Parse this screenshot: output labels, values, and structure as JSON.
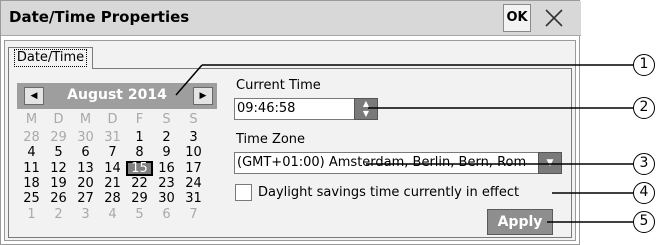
{
  "window": {
    "title": "Date/Time Properties",
    "ok_label": "OK",
    "close_icon": "close-icon"
  },
  "tabs": [
    {
      "label": "Date/Time",
      "active": true
    }
  ],
  "calendar": {
    "month_label": "August 2014",
    "prev_icon": "triangle-left-icon",
    "next_icon": "triangle-right-icon",
    "weekdays": [
      "M",
      "D",
      "M",
      "D",
      "F",
      "S",
      "S"
    ],
    "weeks": [
      [
        "28",
        "29",
        "30",
        "31",
        "1",
        "2",
        "3"
      ],
      [
        "4",
        "5",
        "6",
        "7",
        "8",
        "9",
        "10"
      ],
      [
        "11",
        "12",
        "13",
        "14",
        "15",
        "16",
        "17"
      ],
      [
        "18",
        "19",
        "20",
        "21",
        "22",
        "23",
        "24"
      ],
      [
        "25",
        "26",
        "27",
        "28",
        "29",
        "30",
        "31"
      ],
      [
        "1",
        "2",
        "3",
        "4",
        "5",
        "6",
        "7"
      ]
    ],
    "other_month": [
      [
        0,
        0
      ],
      [
        0,
        1
      ],
      [
        0,
        2
      ],
      [
        0,
        3
      ],
      [
        5,
        0
      ],
      [
        5,
        1
      ],
      [
        5,
        2
      ],
      [
        5,
        3
      ],
      [
        5,
        4
      ],
      [
        5,
        5
      ],
      [
        5,
        6
      ]
    ],
    "selected": [
      2,
      4
    ]
  },
  "current_time": {
    "label": "Current Time",
    "value": "09:46:58"
  },
  "time_zone": {
    "label": "Time Zone",
    "value": "(GMT+01:00) Amsterdam, Berlin, Bern, Rom"
  },
  "daylight": {
    "label": "Daylight savings time currently in effect",
    "checked": false
  },
  "apply_label": "Apply",
  "callouts": [
    "1",
    "2",
    "3",
    "4",
    "5"
  ],
  "colors": {
    "titlebar": "#d8d8d8",
    "panel": "#f2f2f2",
    "calendar_header": "#9e9e9e",
    "button_dark": "#8e8e8e"
  }
}
